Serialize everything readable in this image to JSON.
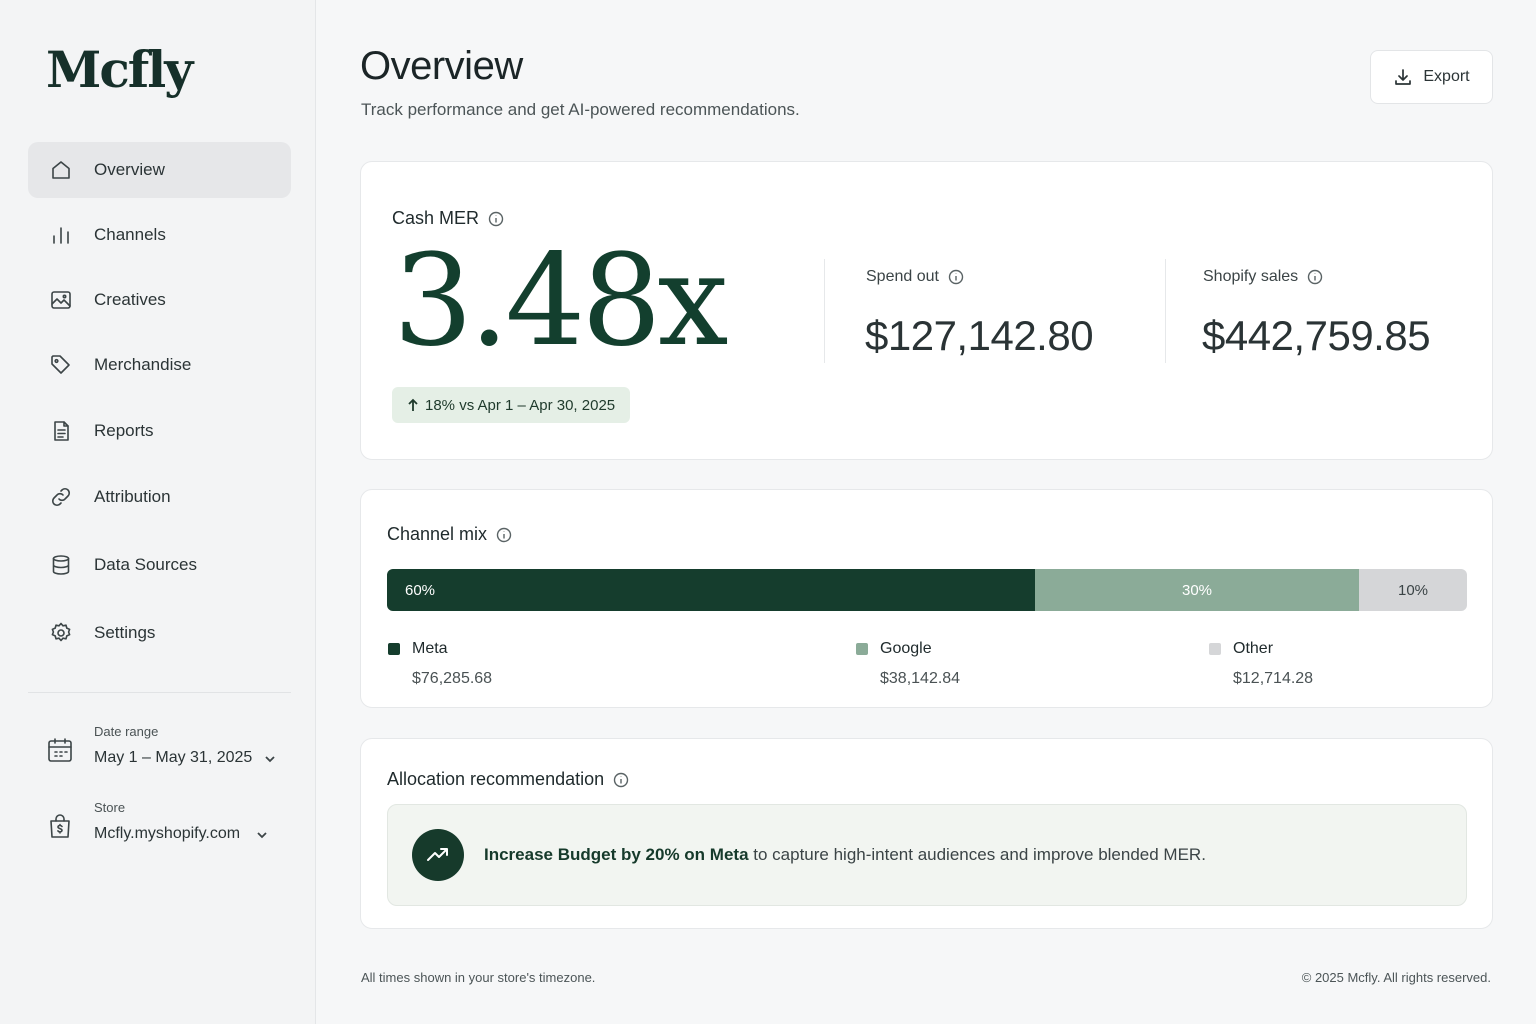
{
  "app": {
    "logo": "Mcfly"
  },
  "sidebar": {
    "items": [
      {
        "label": "Overview",
        "icon": "home-icon",
        "active": true
      },
      {
        "label": "Channels",
        "icon": "bar-chart-icon",
        "active": false
      },
      {
        "label": "Creatives",
        "icon": "image-icon",
        "active": false
      },
      {
        "label": "Merchandise",
        "icon": "tag-icon",
        "active": false
      },
      {
        "label": "Reports",
        "icon": "document-icon",
        "active": false
      },
      {
        "label": "Attribution",
        "icon": "link-icon",
        "active": false
      },
      {
        "label": "Data Sources",
        "icon": "database-icon",
        "active": false
      },
      {
        "label": "Settings",
        "icon": "gear-icon",
        "active": false
      }
    ],
    "date_range": {
      "label": "Date range",
      "value": "May 1 – May 31, 2025"
    },
    "store": {
      "label": "Store",
      "value": "Mcfly.myshopify.com"
    }
  },
  "header": {
    "title": "Overview",
    "subtitle": "Track performance and get AI-powered recommendations.",
    "export_label": "Export"
  },
  "mer_card": {
    "title": "Cash MER",
    "value": "3.48x",
    "change": "18% vs Apr 1 – Apr 30, 2025",
    "spend": {
      "label": "Spend out",
      "value": "$127,142.80"
    },
    "sales": {
      "label": "Shopify sales",
      "value": "$442,759.85"
    }
  },
  "channel_mix": {
    "title": "Channel mix",
    "segments": [
      {
        "name": "Meta",
        "percent_label": "60%",
        "share": 0.6,
        "amount": "$76,285.68",
        "color": "#153d2d"
      },
      {
        "name": "Google",
        "percent_label": "30%",
        "share": 0.3,
        "amount": "$38,142.84",
        "color": "#8bab98"
      },
      {
        "name": "Other",
        "percent_label": "10%",
        "share": 0.1,
        "amount": "$12,714.28",
        "color": "#d5d6d8"
      }
    ]
  },
  "allocation": {
    "title": "Allocation recommendation",
    "highlight": "Increase Budget by 20% on Meta",
    "text": " to capture high-intent audiences and improve blended MER."
  },
  "footer": {
    "left": "All times shown in your store's timezone.",
    "right": "© 2025 Mcfly. All rights reserved."
  },
  "colors": {
    "accent": "#133f2e",
    "badge_bg": "#e5efe6",
    "page_bg": "#f6f7f8"
  }
}
